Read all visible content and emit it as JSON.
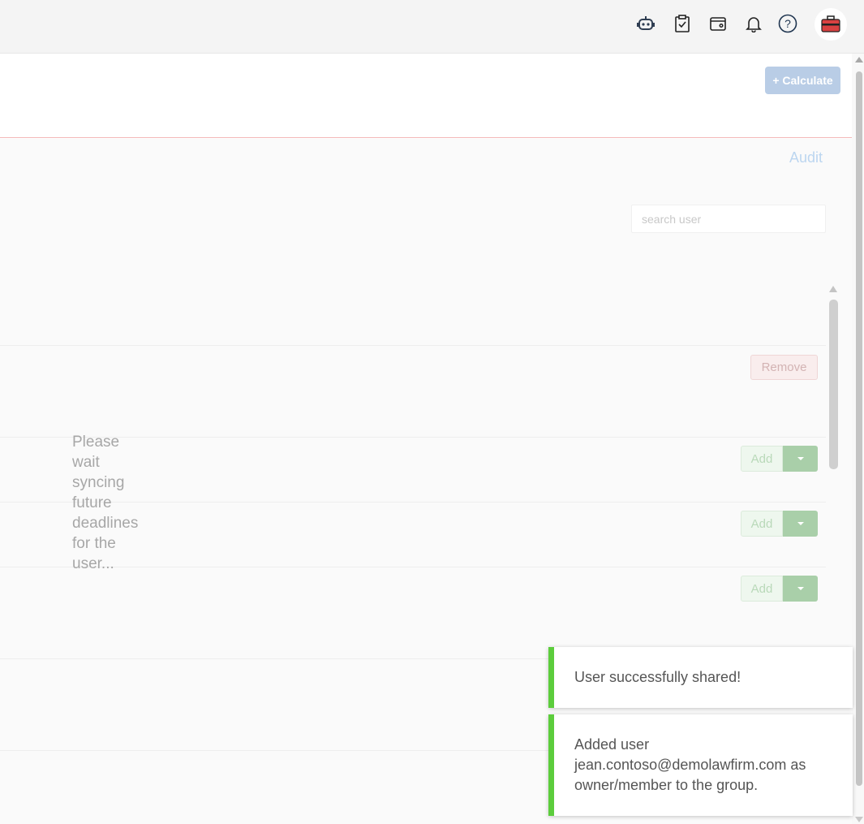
{
  "topbar": {
    "icons": [
      "robot-icon",
      "clipboard-check-icon",
      "wallet-icon",
      "bell-icon",
      "help-icon"
    ],
    "avatar_icon": "toolbox-icon"
  },
  "header": {
    "calculate_label": "+ Calculate"
  },
  "content": {
    "audit_label": "Audit",
    "search_placeholder": "search user",
    "remove_label": "Remove",
    "add_label": "Add",
    "sync_message": "Please wait syncing future deadlines for the user..."
  },
  "toasts": [
    {
      "message": "User successfully shared!"
    },
    {
      "message": "Added user jean.contoso@demolawfirm.com as owner/member to the group."
    }
  ],
  "colors": {
    "toast_accent": "#5ccd3c",
    "calculate_button": "#b9cde6",
    "divider": "#f3b9b9"
  }
}
